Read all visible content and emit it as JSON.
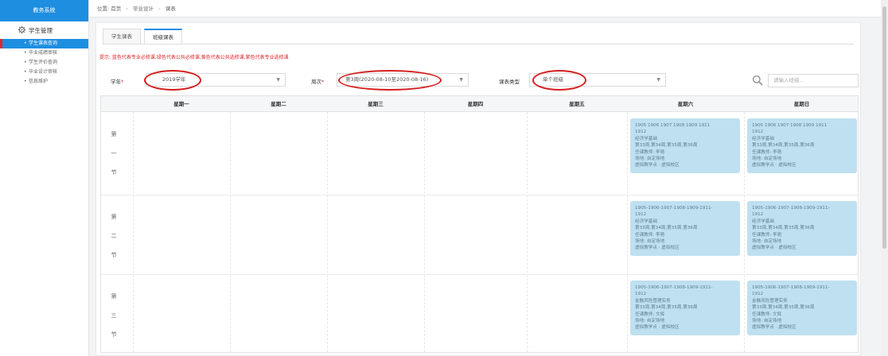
{
  "sidebar": {
    "title": "教务系统",
    "group": "学生管理",
    "items": [
      {
        "label": "学生课表查询",
        "active": true
      },
      {
        "label": "毕业成绩审核",
        "active": false
      },
      {
        "label": "学生评价查询",
        "active": false
      },
      {
        "label": "毕业设计审核",
        "active": false
      },
      {
        "label": "信息维护",
        "active": false
      }
    ]
  },
  "breadcrumb": {
    "prefix": "位置:",
    "items": [
      "首页",
      "毕业设计",
      "课表"
    ]
  },
  "tabs": [
    {
      "label": "学生课表",
      "active": false
    },
    {
      "label": "班级课表",
      "active": true
    }
  ],
  "hint": "提示: 蓝色代表专业必修课,绿色代表公共必修课,黄色代表公共选修课,紫色代表专业选修课",
  "filters": {
    "term_label": "学年",
    "term_value": "2019学年",
    "week_label": "周次",
    "week_value": "第3周(2020-08-10至2020-08-16)",
    "type_label": "课表类型",
    "type_value": "单个班级",
    "search_placeholder": "请输入班级..."
  },
  "table": {
    "days": [
      "星期一",
      "星期二",
      "星期三",
      "星期四",
      "星期五",
      "星期六",
      "星期日"
    ],
    "periods": [
      [
        "第",
        "一",
        "节"
      ],
      [
        "第",
        "二",
        "节"
      ],
      [
        "第",
        "三",
        "节"
      ]
    ],
    "cards": [
      {
        "row": 0,
        "day": 5,
        "lines": [
          "1905 1906 1907 1908 1909 1911",
          "1912",
          "经济学基础",
          "第33周,第34周,第35周,第36周",
          "任课教师: 李艳",
          "场地: 自定场地",
          "虚拟教学点 · 虚拟校区"
        ]
      },
      {
        "row": 0,
        "day": 6,
        "lines": [
          "1905 1906 1907 1908 1909 1911",
          "1912",
          "经济学基础",
          "第33周,第34周,第35周,第36周",
          "任课教师: 李艳",
          "场地: 自定场地",
          "虚拟教学点 · 虚拟校区"
        ]
      },
      {
        "row": 1,
        "day": 5,
        "lines": [
          "1905-1906-1907-1908-1909-1911-",
          "1912",
          "经济学基础",
          "第33周,第34周,第35周,第36周",
          "任课教师: 李艳",
          "场地: 自定场地",
          "虚拟教学点 · 虚拟校区"
        ]
      },
      {
        "row": 1,
        "day": 6,
        "lines": [
          "1905-1906-1907-1908-1909-1911-",
          "1912",
          "经济学基础",
          "第33周,第34周,第35周,第36周",
          "任课教师: 李艳",
          "场地: 自定场地",
          "虚拟教学点 · 虚拟校区"
        ]
      },
      {
        "row": 2,
        "day": 5,
        "lines": [
          "1905-1906-1907-1908-1909-1911-",
          "1912",
          "金融风险管理实务",
          "第33周,第34周,第35周,第36周",
          "任课教师: 文辉",
          "场地: 自定场地",
          "虚拟教学点 · 虚拟校区"
        ]
      },
      {
        "row": 2,
        "day": 6,
        "lines": [
          "1905-1906-1907-1908-1909-1911-",
          "1912",
          "金融风险管理实务",
          "第33周,第34周,第35周,第36周",
          "任课教师: 文辉",
          "场地: 自定场地",
          "虚拟教学点 · 虚拟校区"
        ]
      }
    ]
  },
  "colors": {
    "primary": "#1e8ee0",
    "card": "#bfe0f1",
    "highlight_ring": "#d61e1e",
    "hint": "#e0262b"
  },
  "icons": {
    "sidebar_group": "gear-icon",
    "search": "search-icon"
  }
}
